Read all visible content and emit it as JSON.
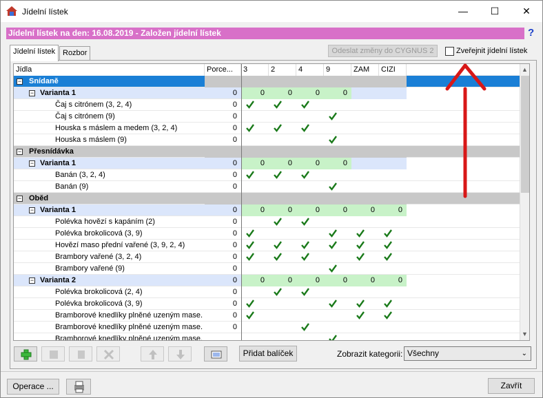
{
  "window": {
    "title": "Jídelní lístek",
    "min": "—",
    "max": "☐",
    "close": "✕"
  },
  "banner": "Jídelní lístek na den: 16.08.2019 - Založen jídelní lístek",
  "help": "?",
  "tabs": [
    {
      "label": "Jídelní lístek",
      "active": true
    },
    {
      "label": "Rozbor",
      "active": false
    }
  ],
  "send_button": "Odeslat změny do CYGNUS 2",
  "publish_checkbox": {
    "label": "Zveřejnit jídelní lístek",
    "checked": false
  },
  "columns": [
    "Jídla",
    "Porce...",
    "3",
    "2",
    "4",
    "9",
    "ZAM",
    "CIZI"
  ],
  "rows": [
    {
      "level": 0,
      "label": "Snídaně",
      "selected": true
    },
    {
      "level": 1,
      "label": "Varianta 1",
      "porce": "0",
      "values": [
        "0",
        "0",
        "0",
        "0",
        "",
        ""
      ]
    },
    {
      "level": 2,
      "label": "Čaj s citrónem (3, 2, 4)",
      "porce": "0",
      "checks": [
        1,
        1,
        1,
        0,
        0,
        0
      ]
    },
    {
      "level": 2,
      "label": "Čaj s citrónem (9)",
      "porce": "0",
      "checks": [
        0,
        0,
        0,
        1,
        0,
        0
      ]
    },
    {
      "level": 2,
      "label": "Houska s máslem a medem (3, 2, 4)",
      "porce": "0",
      "checks": [
        1,
        1,
        1,
        0,
        0,
        0
      ]
    },
    {
      "level": 2,
      "label": "Houska s máslem (9)",
      "porce": "0",
      "checks": [
        0,
        0,
        0,
        1,
        0,
        0
      ]
    },
    {
      "level": 0,
      "label": "Přesnídávka"
    },
    {
      "level": 1,
      "label": "Varianta 1",
      "porce": "0",
      "values": [
        "0",
        "0",
        "0",
        "0",
        "",
        ""
      ]
    },
    {
      "level": 2,
      "label": "Banán (3, 2, 4)",
      "porce": "0",
      "checks": [
        1,
        1,
        1,
        0,
        0,
        0
      ]
    },
    {
      "level": 2,
      "label": "Banán (9)",
      "porce": "0",
      "checks": [
        0,
        0,
        0,
        1,
        0,
        0
      ]
    },
    {
      "level": 0,
      "label": "Oběd"
    },
    {
      "level": 1,
      "label": "Varianta 1",
      "porce": "0",
      "values": [
        "0",
        "0",
        "0",
        "0",
        "0",
        "0"
      ]
    },
    {
      "level": 2,
      "label": "Polévka hovězí s kapáním (2)",
      "porce": "0",
      "checks": [
        0,
        1,
        1,
        0,
        0,
        0
      ]
    },
    {
      "level": 2,
      "label": "Polévka brokolicová (3, 9)",
      "porce": "0",
      "checks": [
        1,
        0,
        0,
        1,
        1,
        1
      ]
    },
    {
      "level": 2,
      "label": "Hovězí maso přední vařené (3, 9, 2, 4)",
      "porce": "0",
      "checks": [
        1,
        1,
        1,
        1,
        1,
        1
      ]
    },
    {
      "level": 2,
      "label": "Brambory vařené (3, 2, 4)",
      "porce": "0",
      "checks": [
        1,
        1,
        1,
        0,
        1,
        1
      ]
    },
    {
      "level": 2,
      "label": "Brambory vařené (9)",
      "porce": "0",
      "checks": [
        0,
        0,
        0,
        1,
        0,
        0
      ]
    },
    {
      "level": 1,
      "label": "Varianta 2",
      "porce": "0",
      "values": [
        "0",
        "0",
        "0",
        "0",
        "0",
        "0"
      ]
    },
    {
      "level": 2,
      "label": "Polévka brokolicová (2, 4)",
      "porce": "0",
      "checks": [
        0,
        1,
        1,
        0,
        0,
        0
      ]
    },
    {
      "level": 2,
      "label": "Polévka brokolicová (3, 9)",
      "porce": "0",
      "checks": [
        1,
        0,
        0,
        1,
        1,
        1
      ]
    },
    {
      "level": 2,
      "label": "Bramborové knedlíky plněné uzeným mase...",
      "porce": "0",
      "checks": [
        1,
        0,
        0,
        0,
        1,
        1
      ]
    },
    {
      "level": 2,
      "label": "Bramborové knedlíky plněné uzeným mase...",
      "porce": "0",
      "checks": [
        0,
        0,
        1,
        0,
        0,
        0
      ]
    },
    {
      "level": 2,
      "label": "Bramborové knedlíky plněné uzeným mase...",
      "porce": "",
      "checks": [
        0,
        0,
        0,
        1,
        0,
        0
      ]
    }
  ],
  "toolbar": {
    "add_icon": "plus-icon",
    "pridat_balicek": "Přidat balíček",
    "category_label": "Zobrazit kategorii:",
    "category_value": "Všechny"
  },
  "footer": {
    "operace": "Operace ...",
    "zavrit": "Zavřít"
  },
  "colors": {
    "banner": "#d870c8",
    "section_selected": "#1a7fd6",
    "section": "#c8c8c8",
    "variant": "#dbe6fb",
    "variant_values": "#c8f2c8",
    "check": "#1a7a1a",
    "annotation": "#d81818"
  }
}
